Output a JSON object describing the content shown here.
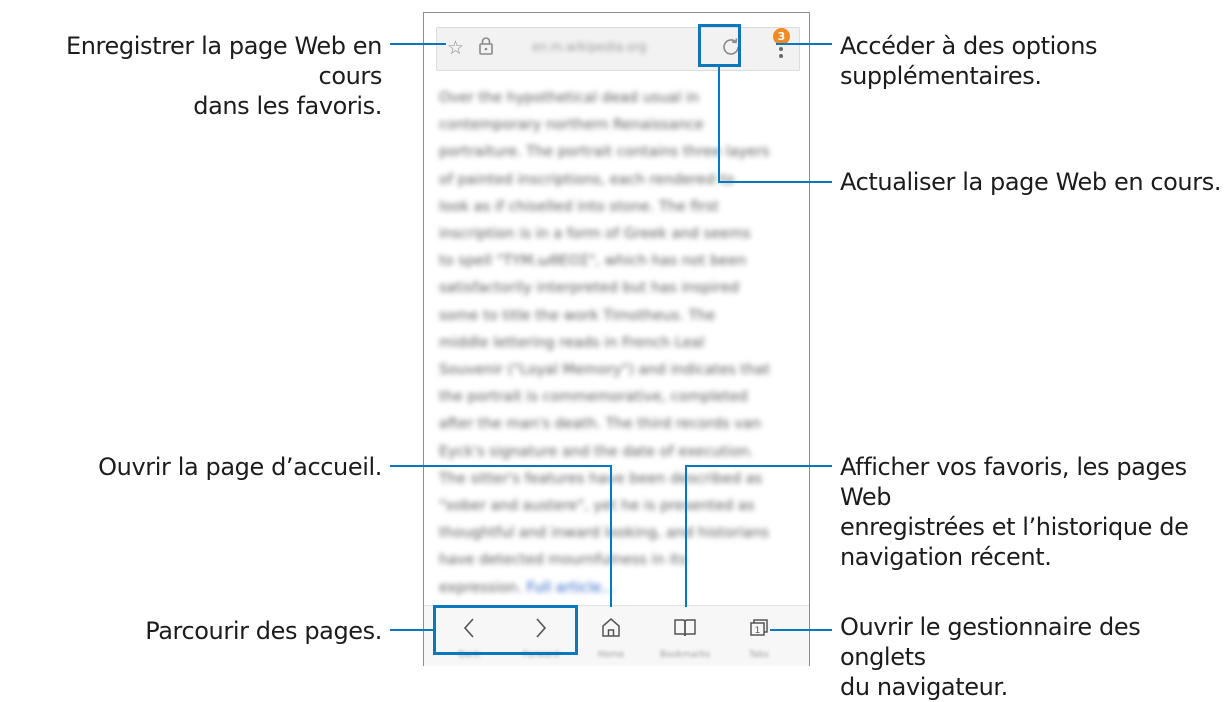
{
  "phone": {
    "url": "en.m.wikipedia.org",
    "tab_count": "1",
    "menu_badge": "3",
    "article_lines": [
      "Over the hypothetical dead usual in",
      "contemporary northern Renaissance",
      "portraiture. The portrait contains three layers",
      "of painted inscriptions, each rendered to",
      "look as if chiselled into stone. The first",
      "inscription is in a form of Greek and seems",
      "to spell \"TYM.ωθΕΟΣ\", which has not been",
      "satisfactorily interpreted but has inspired",
      "some to title the work Timotheus. The",
      "middle lettering reads in French Leal",
      "Souvenir (\"Loyal Memory\") and indicates that",
      "the portrait is commemorative, completed",
      "after the man's death. The third records van",
      "Eyck's signature and the date of execution.",
      "The sitter's features have been described as",
      "\"sober and austere\", yet he is presented as",
      "thoughtful and inward looking, and historians",
      "have detected mournfulness in its",
      "expression."
    ],
    "article_link": "Full article...",
    "nav": {
      "back_label": "Back",
      "forward_label": "Forward",
      "home_label": "Home",
      "bookmarks_label": "Bookmarks",
      "tabs_label": "Tabs"
    }
  },
  "callouts": {
    "bookmark": "Enregistrer la page Web en cours dans les favoris.",
    "bookmark_line1": "Enregistrer la page Web en cours",
    "bookmark_line2": "dans les favoris.",
    "more_line1": "Accéder à des options",
    "more_line2": "supplémentaires.",
    "refresh": "Actualiser la page Web en cours.",
    "home": "Ouvrir la page d’accueil.",
    "bookmarks_line1": "Afficher vos favoris, les pages Web",
    "bookmarks_line2": "enregistrées et l’historique de",
    "bookmarks_line3": "navigation récent.",
    "navigate": "Parcourir des pages.",
    "tabs_line1": "Ouvrir le gestionnaire des onglets",
    "tabs_line2": "du navigateur."
  },
  "colors": {
    "accent": "#0a78bd",
    "badge": "#f08a24"
  }
}
